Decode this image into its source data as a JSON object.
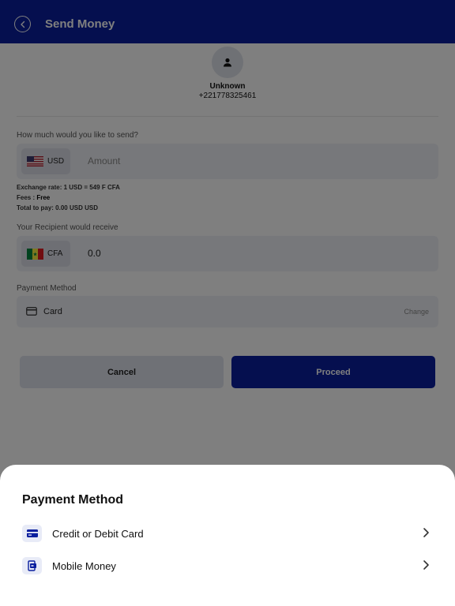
{
  "header": {
    "title": "Send Money",
    "back_icon": "chevron-left-icon",
    "bg_color": "#0a1f9e"
  },
  "recipient": {
    "avatar_icon": "person-icon",
    "name": "Unknown",
    "phone": "+221778325461"
  },
  "send": {
    "label": "How much would you like to send?",
    "currency": "USD",
    "flag_icon": "us-flag-icon",
    "placeholder": "Amount"
  },
  "exchange": {
    "rate_text": "Exchange rate: 1 USD = 549 F CFA",
    "fees_label": "Fees : ",
    "fees_value": "Free",
    "total_text": "Total to pay: 0.00 USD USD"
  },
  "receive": {
    "label": "Your Recipient would receive",
    "currency": "CFA",
    "flag_icon": "senegal-flag-icon",
    "value": "0.0"
  },
  "payment": {
    "label": "Payment Method",
    "card_icon": "credit-card-icon",
    "method": "Card",
    "change_label": "Change"
  },
  "actions": {
    "cancel_label": "Cancel",
    "proceed_label": "Proceed"
  },
  "sheet": {
    "title": "Payment Method",
    "options": [
      {
        "label": "Credit or Debit Card",
        "icon": "credit-card-icon"
      },
      {
        "label": "Mobile Money",
        "icon": "mobile-money-icon"
      }
    ]
  }
}
